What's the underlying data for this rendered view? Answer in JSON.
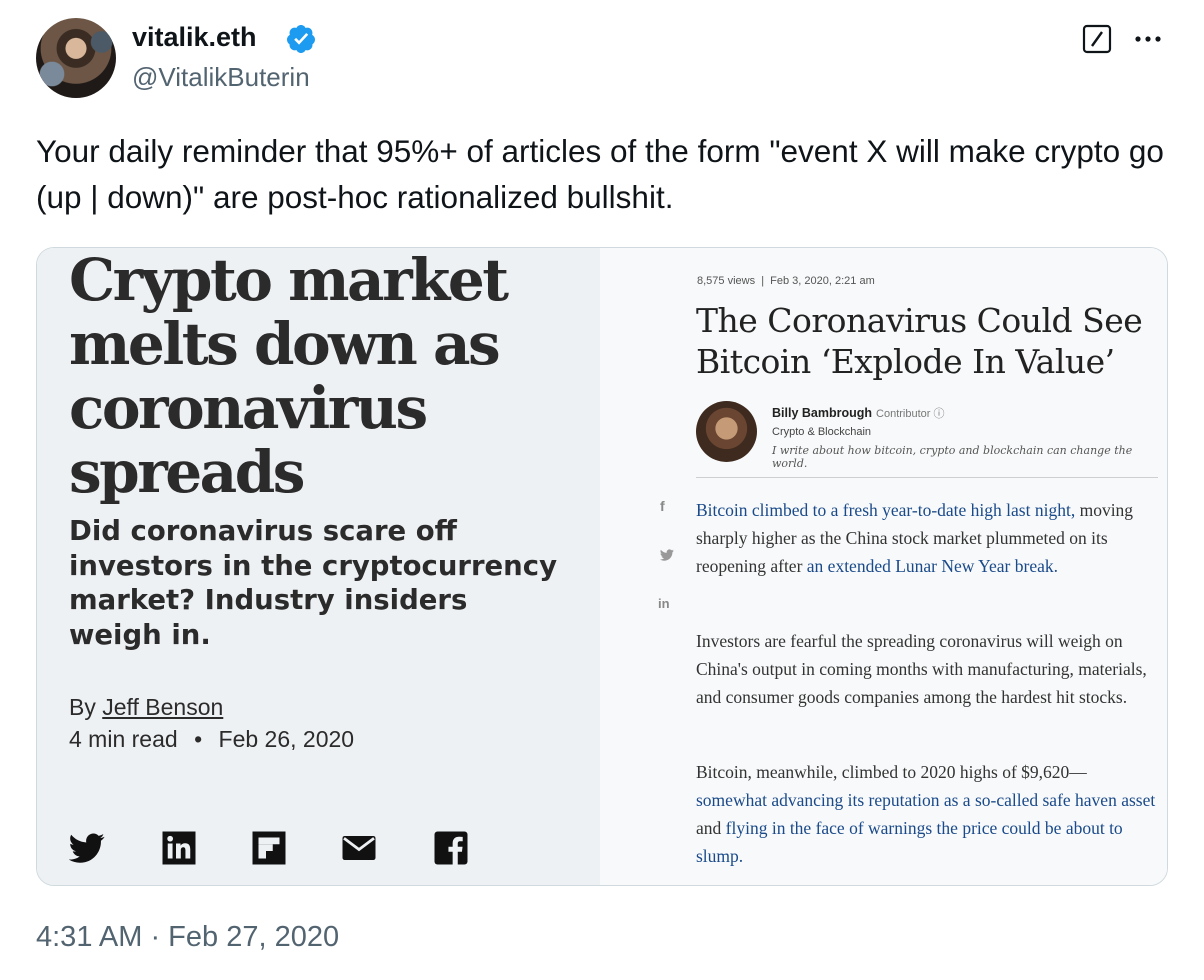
{
  "tweet": {
    "display_name": "vitalik.eth",
    "handle": "@VitalikButerin",
    "text": "Your daily reminder that 95%+ of articles of the form \"event X will make crypto go (up | down)\" are post-hoc rationalized bullshit.",
    "timestamp": "4:31 AM · Feb 27, 2020",
    "verified_color": "#1d9bf0"
  },
  "left_article": {
    "headline": "Crypto market melts down as coronavirus spreads",
    "subheadline": "Did coronavirus scare off investors in the cryptocurrency market? Industry insiders weigh in.",
    "by_prefix": "By",
    "author": "Jeff Benson",
    "read_time": "4 min read",
    "separator": "•",
    "date": "Feb 26, 2020",
    "share_icons": [
      "twitter-icon",
      "linkedin-icon",
      "flipboard-icon",
      "email-icon",
      "facebook-icon"
    ]
  },
  "right_article": {
    "meta": "8,575 views  |  Feb 3, 2020, 2:21 am",
    "title": "The Coronavirus Could See Bitcoin ‘Explode In Value’",
    "author": "Billy Bambrough",
    "author_role": "Contributor ⓘ",
    "section": "Crypto & Blockchain",
    "bio": "I write about how bitcoin, crypto and blockchain can change the world.",
    "social": [
      "f",
      "᾿",
      "in"
    ],
    "para1_link1": "Bitcoin climbed to a fresh year-to-date high last night,",
    "para1_text": " moving sharply higher as the China stock market plummeted on its reopening after ",
    "para1_link2": "an extended Lunar New Year break.",
    "para2": "Investors are fearful the spreading coronavirus will weigh on China's output in coming months with manufacturing, materials, and consumer goods companies among the hardest hit stocks.",
    "para3_text1": "Bitcoin, meanwhile, climbed to 2020 highs of $9,620—",
    "para3_link1": "somewhat advancing its reputation as a so-called safe haven asset",
    "para3_text2": " and ",
    "para3_link2": "flying in the face of warnings the price could be about to slump."
  }
}
